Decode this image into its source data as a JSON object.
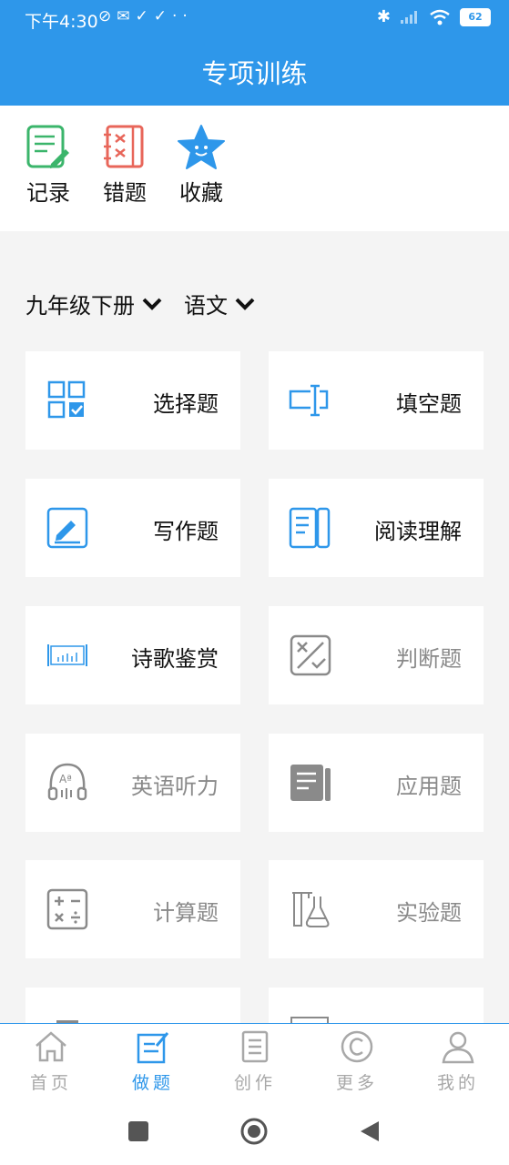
{
  "status": {
    "time": "下午4:30",
    "battery": "62"
  },
  "header": {
    "title": "专项训练"
  },
  "toolbar": [
    {
      "label": "记录"
    },
    {
      "label": "错题"
    },
    {
      "label": "收藏"
    }
  ],
  "filters": {
    "grade": "九年级下册",
    "subject": "语文"
  },
  "cards": [
    {
      "label": "选择题"
    },
    {
      "label": "填空题"
    },
    {
      "label": "写作题"
    },
    {
      "label": "阅读理解"
    },
    {
      "label": "诗歌鉴赏"
    },
    {
      "label": "判断题"
    },
    {
      "label": "英语听力"
    },
    {
      "label": "应用题"
    },
    {
      "label": "计算题"
    },
    {
      "label": "实验题"
    }
  ],
  "tabs": [
    {
      "label": "首页"
    },
    {
      "label": "做题"
    },
    {
      "label": "创作"
    },
    {
      "label": "更多"
    },
    {
      "label": "我的"
    }
  ],
  "colors": {
    "primary": "#2e97ea",
    "disabled": "#8a8a8a",
    "inactive_tab": "#a8a8a8"
  }
}
